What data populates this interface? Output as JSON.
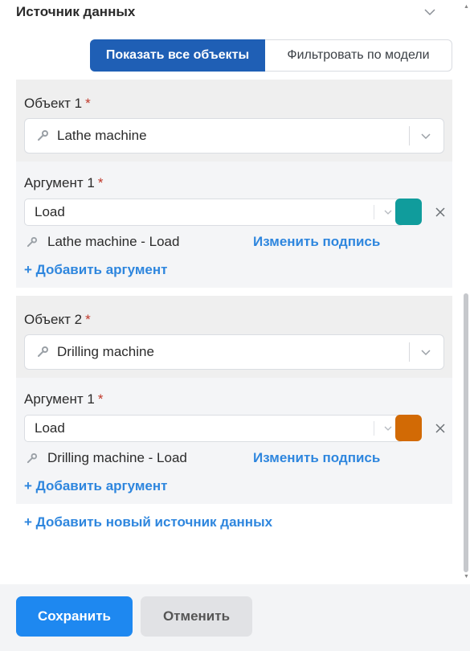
{
  "header": {
    "title": "Источник данных",
    "collapse_icon": "chevron-down-icon"
  },
  "mode_toggle": {
    "active_label": "Показать все объекты",
    "inactive_label": "Фильтровать по модели"
  },
  "objects": [
    {
      "label": "Объект 1",
      "required_mark": "*",
      "value": "Lathe machine",
      "argument": {
        "label": "Аргумент 1",
        "required_mark": "*",
        "value": "Load",
        "color": "#109c9c",
        "series_name": "Lathe machine - Load",
        "rename_label": "Изменить подпись"
      },
      "add_argument_label": "+ Добавить аргумент"
    },
    {
      "label": "Объект 2",
      "required_mark": "*",
      "value": "Drilling machine",
      "argument": {
        "label": "Аргумент 1",
        "required_mark": "*",
        "value": "Load",
        "color": "#d26a05",
        "series_name": "Drilling machine - Load",
        "rename_label": "Изменить подпись"
      },
      "add_argument_label": "+ Добавить аргумент"
    }
  ],
  "add_source_label": "+ Добавить новый источник данных",
  "footer": {
    "save_label": "Сохранить",
    "cancel_label": "Отменить"
  },
  "colors": {
    "primary_dark": "#1f5fb5",
    "primary": "#1e88f0",
    "link": "#2e86de",
    "required": "#c0392b"
  }
}
